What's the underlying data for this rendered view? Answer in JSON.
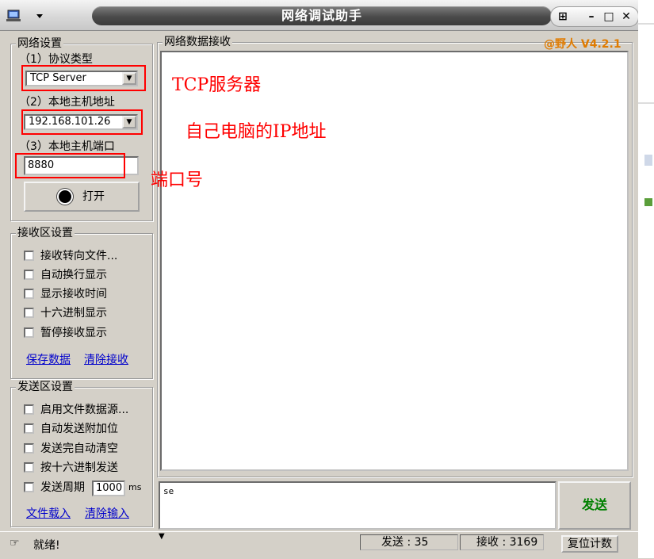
{
  "window": {
    "title": "网络调试助手",
    "version_tag": "@野人 V4.2.1",
    "controls": {
      "pin": "⊞",
      "minimize": "–",
      "maximize": "□",
      "close": "✕"
    }
  },
  "network_settings": {
    "legend": "网络设置",
    "protocol_label": "（1）协议类型",
    "protocol_value": "TCP Server",
    "host_label": "（2）本地主机地址",
    "host_value": "192.168.101.26",
    "port_label": "（3）本地主机端口",
    "port_value": "8880",
    "open_button": "打开"
  },
  "receive_settings": {
    "legend": "接收区设置",
    "options": [
      {
        "label": "接收转向文件...",
        "checked": false
      },
      {
        "label": "自动换行显示",
        "checked": false
      },
      {
        "label": "显示接收时间",
        "checked": false
      },
      {
        "label": "十六进制显示",
        "checked": false
      },
      {
        "label": "暂停接收显示",
        "checked": false
      }
    ],
    "save_link": "保存数据",
    "clear_link": "清除接收"
  },
  "send_settings": {
    "legend": "发送区设置",
    "options": [
      {
        "label": "启用文件数据源...",
        "checked": false
      },
      {
        "label": "自动发送附加位",
        "checked": false
      },
      {
        "label": "发送完自动清空",
        "checked": false
      },
      {
        "label": "按十六进制发送",
        "checked": false
      }
    ],
    "period_label": "发送周期",
    "period_value": "1000",
    "period_unit": "ms",
    "load_link": "文件载入",
    "clear_link": "清除输入"
  },
  "receive_panel": {
    "legend": "网络数据接收"
  },
  "send_panel": {
    "input_value": "se",
    "send_button": "发送"
  },
  "status": {
    "ready": "就绪!",
    "sent_label": "发送 : 35",
    "recv_label": "接收 : 3169",
    "reset_button": "复位计数"
  },
  "annotations": {
    "protocol_note": "TCP服务器",
    "host_note": "自己电脑的IP地址",
    "port_note": "端口号"
  },
  "colors": {
    "annotation": "#ff0000",
    "version": "#e07b00",
    "link": "#0000cc",
    "send_button_text": "#008000"
  }
}
